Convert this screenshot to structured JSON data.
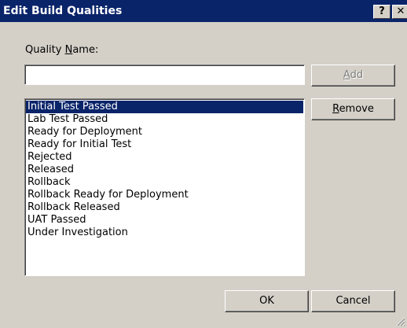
{
  "window": {
    "title": "Edit Build Qualities",
    "help_label": "?",
    "close_label": "✕"
  },
  "quality_name": {
    "label_prefix": "Quality ",
    "label_accel": "N",
    "label_suffix": "ame:",
    "value": ""
  },
  "buttons": {
    "add_prefix": "",
    "add_accel": "A",
    "add_suffix": "dd",
    "remove_prefix": "",
    "remove_accel": "R",
    "remove_suffix": "emove",
    "ok": "OK",
    "cancel": "Cancel"
  },
  "qualities": {
    "selected_index": 0,
    "items": [
      "Initial Test Passed",
      "Lab Test Passed",
      "Ready for Deployment",
      "Ready for Initial Test",
      "Rejected",
      "Released",
      "Rollback",
      "Rollback Ready for Deployment",
      "Rollback Released",
      "UAT Passed",
      "Under Investigation"
    ]
  },
  "colors": {
    "titlebar": "#0a246a",
    "dialog": "#d4d0c8",
    "selection": "#0a246a"
  }
}
